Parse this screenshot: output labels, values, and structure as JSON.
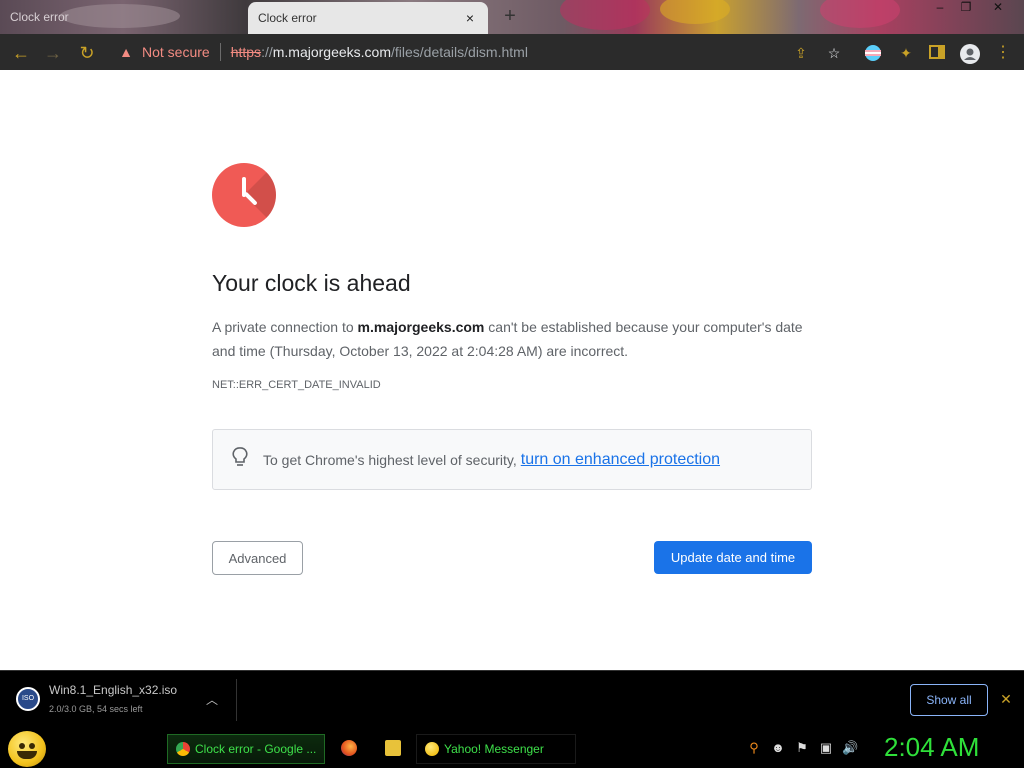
{
  "tabs": [
    {
      "title": "Clock error",
      "active": false
    },
    {
      "title": "Clock error",
      "active": true,
      "close_glyph": "×"
    }
  ],
  "new_tab_glyph": "+",
  "window_controls": {
    "minimize": "‒",
    "restore": "❐",
    "close": "✕"
  },
  "toolbar": {
    "back_icon": "←",
    "forward_icon": "→",
    "reload_icon": "↻",
    "security_label": "Not secure",
    "url": {
      "scheme": "https",
      "separator": "://",
      "host": "m.majorgeeks.com",
      "path": "/files/details/dism.html"
    }
  },
  "page": {
    "heading": "Your clock is ahead",
    "desc_before": "A private connection to ",
    "desc_host": "m.majorgeeks.com",
    "desc_after": " can't be established because your computer's date and time (Thursday, October 13, 2022 at 2:04:28 AM) are incorrect.",
    "error_code": "NET::ERR_CERT_DATE_INVALID",
    "promo_text": "To get Chrome's highest level of security,",
    "promo_link": "turn on enhanced protection",
    "advanced_button": "Advanced",
    "update_button": "Update date and time"
  },
  "download": {
    "file_name": "Win8.1_English_x32.iso",
    "status": "2.0/3.0 GB, 54 secs left",
    "icon_label": "ISO",
    "show_all": "Show all",
    "close_glyph": "✕"
  },
  "taskbar": {
    "tasks": [
      {
        "label": "Clock error - Google ..."
      },
      {
        "label": "Yahoo! Messenger"
      }
    ],
    "clock": "2:04 AM"
  },
  "colors": {
    "accent_blue": "#1a73e8",
    "error_red": "#f05a55",
    "not_secure_red": "#f28b82",
    "taskbar_green": "#2fe03a",
    "toolbar_dark": "#2b2b2b"
  }
}
